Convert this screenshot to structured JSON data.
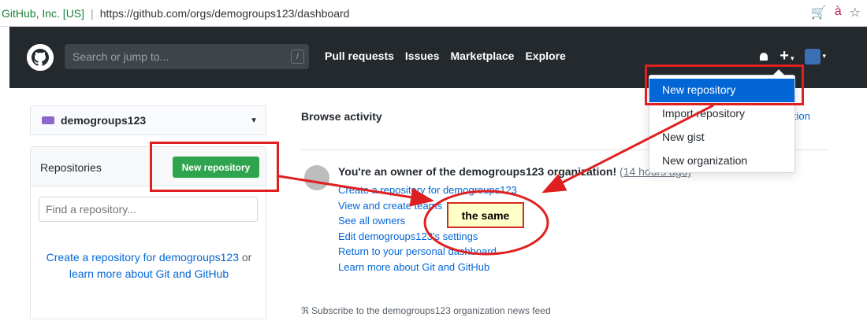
{
  "browser": {
    "secure_label": "GitHub, Inc. [US]",
    "separator": "|",
    "url": "https://github.com/orgs/demogroups123/dashboard"
  },
  "header": {
    "search_placeholder": "Search or jump to...",
    "search_shortcut": "/",
    "nav": [
      "Pull requests",
      "Issues",
      "Marketplace",
      "Explore"
    ],
    "plus": "+",
    "caret": "▾"
  },
  "sidebar": {
    "org_name": "demogroups123",
    "repos_title": "Repositories",
    "new_repo_button": "New repository",
    "find_placeholder": "Find a repository...",
    "help_link1": "Create a repository for demogroups123",
    "help_mid": " or ",
    "help_link2": "learn more about Git and GitHub"
  },
  "main": {
    "browse_activity": "Browse activity",
    "org_link_fragment": "nization",
    "owner_title": "You're an owner of the demogroups123 organization!",
    "owner_time": "(14 hours ago)",
    "links": [
      "Create a repository for demogroups123",
      "View and create teams",
      "See all owners",
      "Edit demogroups123's settings",
      "Return to your personal dashboard",
      "Learn more about Git and GitHub"
    ],
    "subscribe": "Subscribe to the demogroups123 organization news feed"
  },
  "menu": {
    "items": [
      "New repository",
      "Import repository",
      "New gist",
      "New organization"
    ]
  },
  "annotation": {
    "note": "the same"
  },
  "colors": {
    "header_bg": "#24292e",
    "accent_blue": "#0366d6",
    "green_button": "#2ea44f",
    "annotation_red": "#e02020"
  }
}
